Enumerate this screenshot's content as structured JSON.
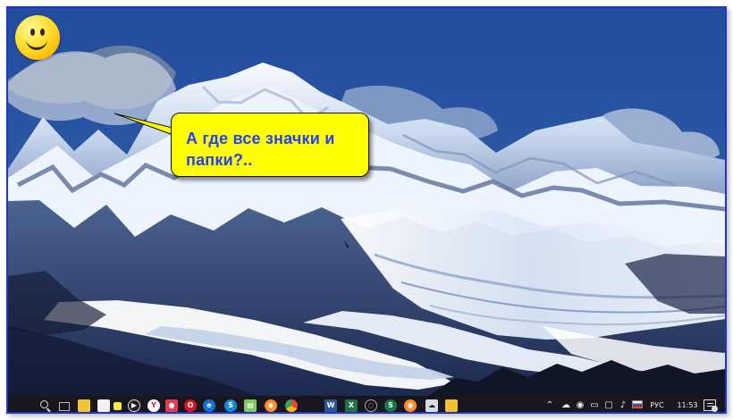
{
  "desktop": {
    "wallpaper": "mountain-glacier-wallpaper",
    "speech_bubble": {
      "line1": "А где все значки и",
      "line2": "папки?.."
    },
    "smiley": "smiley-face-icon"
  },
  "taskbar": {
    "apps": [
      {
        "name": "start-menu",
        "icon": "windows-logo-icon"
      },
      {
        "name": "search",
        "icon": "search-icon"
      },
      {
        "name": "task-view",
        "icon": "task-view-icon"
      },
      {
        "name": "explorer",
        "icon": "folder-icon"
      },
      {
        "name": "notepad",
        "icon": "notepad-icon"
      },
      {
        "name": "small-app",
        "icon": "small-app-icon"
      },
      {
        "name": "media-player",
        "icon": "media-player-icon"
      },
      {
        "name": "yandex-browser",
        "icon": "yandex-icon"
      },
      {
        "name": "camera-app",
        "icon": "camera-icon"
      },
      {
        "name": "opera-browser",
        "icon": "opera-icon"
      },
      {
        "name": "edge-browser",
        "icon": "edge-icon"
      },
      {
        "name": "skype",
        "icon": "skype-icon"
      },
      {
        "name": "notes-app",
        "icon": "notes-icon"
      },
      {
        "name": "firefox-browser",
        "icon": "firefox-icon"
      },
      {
        "name": "chrome-browser",
        "icon": "chrome-icon"
      },
      {
        "name": "word",
        "icon": "word-icon"
      },
      {
        "name": "excel",
        "icon": "excel-icon"
      },
      {
        "name": "unknown-app",
        "icon": "app-icon"
      },
      {
        "name": "spreadsheet-app",
        "icon": "spreadsheet-icon"
      },
      {
        "name": "firefox-second",
        "icon": "firefox-icon"
      },
      {
        "name": "cloud-app",
        "icon": "cloud-icon"
      },
      {
        "name": "folder-app",
        "icon": "folder-icon"
      }
    ],
    "tray": {
      "language": "РУС",
      "time": "11:53"
    }
  },
  "colors": {
    "bubble_fill": "#ffff00",
    "bubble_text": "#2440ff",
    "frame_border": "#1e35d0",
    "taskbar": "#19171d"
  }
}
